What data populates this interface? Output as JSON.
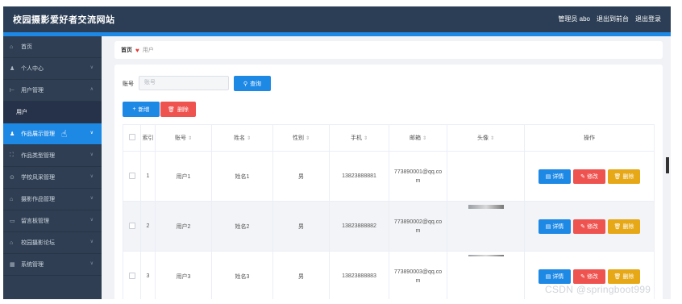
{
  "header": {
    "title": "校园摄影爱好者交流网站",
    "admin_text": "管理员 abo",
    "back_label": "退出到前台",
    "logout_label": "退出登录"
  },
  "sidebar": {
    "items": [
      {
        "label": "首页",
        "icon": "home-icon"
      },
      {
        "label": "个人中心",
        "icon": "user-icon"
      },
      {
        "label": "用户管理",
        "icon": "users-icon"
      },
      {
        "label": "用户",
        "icon": ""
      },
      {
        "label": "作品展示管理",
        "icon": "user-icon"
      },
      {
        "label": "作品类型管理",
        "icon": "expand-icon"
      },
      {
        "label": "学校风采管理",
        "icon": "compass-icon"
      },
      {
        "label": "摄影作品管理",
        "icon": "bank-icon"
      },
      {
        "label": "留言板管理",
        "icon": "message-icon"
      },
      {
        "label": "校园摄影论坛",
        "icon": "bank-icon"
      },
      {
        "label": "系统管理",
        "icon": "grid-icon"
      }
    ]
  },
  "breadcrumb": {
    "home": "首页",
    "current": "用户"
  },
  "search": {
    "label": "账号",
    "placeholder": "账号",
    "query_label": "查询"
  },
  "actions": {
    "add_label": "新增",
    "delete_label": "删除"
  },
  "table": {
    "headers": [
      "索引",
      "账号",
      "姓名",
      "性别",
      "手机",
      "邮箱",
      "头像",
      "操作"
    ],
    "rows": [
      {
        "index": "1",
        "account": "用户1",
        "name": "姓名1",
        "gender": "男",
        "phone": "13823888881",
        "email": "773890001@qq.com"
      },
      {
        "index": "2",
        "account": "用户2",
        "name": "姓名2",
        "gender": "男",
        "phone": "13823888882",
        "email": "773890002@qq.com"
      },
      {
        "index": "3",
        "account": "用户3",
        "name": "姓名3",
        "gender": "男",
        "phone": "13823888883",
        "email": "773890003@qq.com"
      }
    ],
    "op_detail": "详情",
    "op_edit": "修改",
    "op_delete": "删除"
  },
  "watermark": "CSDN @springboot999",
  "colors": {
    "header_bg": "#2c3e55",
    "accent": "#1e88e5",
    "danger": "#ef5350",
    "warning": "#e6a817",
    "sidebar_bg": "#2f3e52"
  }
}
